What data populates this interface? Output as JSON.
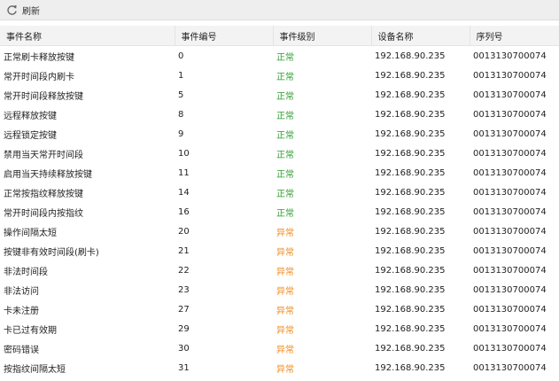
{
  "toolbar": {
    "refresh_label": "刷新",
    "refresh_icon": "refresh-icon"
  },
  "table": {
    "columns": [
      "事件名称",
      "事件编号",
      "事件级别",
      "设备名称",
      "序列号"
    ],
    "rows": [
      [
        "正常刷卡释放按键",
        "0",
        "正常",
        "192.168.90.235",
        "0013130700074"
      ],
      [
        "常开时间段内刷卡",
        "1",
        "正常",
        "192.168.90.235",
        "0013130700074"
      ],
      [
        "常开时间段释放按键",
        "5",
        "正常",
        "192.168.90.235",
        "0013130700074"
      ],
      [
        "远程释放按键",
        "8",
        "正常",
        "192.168.90.235",
        "0013130700074"
      ],
      [
        "远程锁定按键",
        "9",
        "正常",
        "192.168.90.235",
        "0013130700074"
      ],
      [
        "禁用当天常开时间段",
        "10",
        "正常",
        "192.168.90.235",
        "0013130700074"
      ],
      [
        "启用当天持续释放按键",
        "11",
        "正常",
        "192.168.90.235",
        "0013130700074"
      ],
      [
        "正常按指纹释放按键",
        "14",
        "正常",
        "192.168.90.235",
        "0013130700074"
      ],
      [
        "常开时间段内按指纹",
        "16",
        "正常",
        "192.168.90.235",
        "0013130700074"
      ],
      [
        "操作间隔太短",
        "20",
        "异常",
        "192.168.90.235",
        "0013130700074"
      ],
      [
        "按键非有效时间段(刷卡)",
        "21",
        "异常",
        "192.168.90.235",
        "0013130700074"
      ],
      [
        "非法时间段",
        "22",
        "异常",
        "192.168.90.235",
        "0013130700074"
      ],
      [
        "非法访问",
        "23",
        "异常",
        "192.168.90.235",
        "0013130700074"
      ],
      [
        "卡未注册",
        "27",
        "异常",
        "192.168.90.235",
        "0013130700074"
      ],
      [
        "卡已过有效期",
        "29",
        "异常",
        "192.168.90.235",
        "0013130700074"
      ],
      [
        "密码错误",
        "30",
        "异常",
        "192.168.90.235",
        "0013130700074"
      ],
      [
        "按指纹间隔太短",
        "31",
        "异常",
        "192.168.90.235",
        "0013130700074"
      ]
    ]
  },
  "colors": {
    "normal": "#2e9e2e",
    "abnormal": "#f08a1c"
  }
}
